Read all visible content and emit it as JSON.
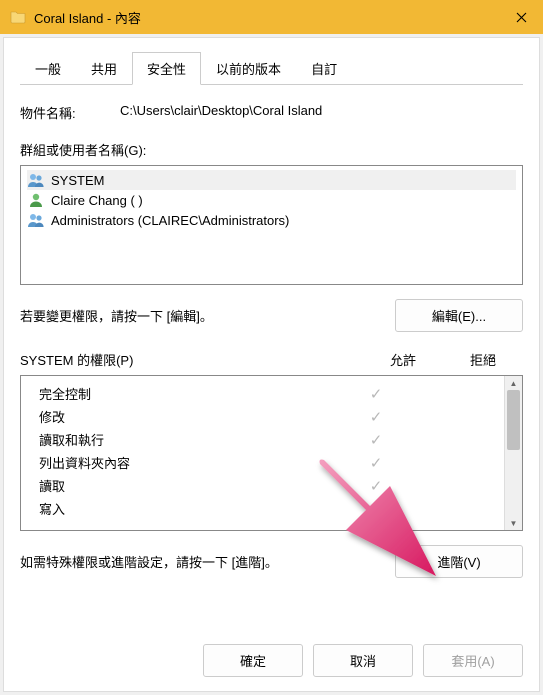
{
  "titlebar": {
    "title": "Coral Island - 內容"
  },
  "tabs": {
    "general": "一般",
    "sharing": "共用",
    "security": "安全性",
    "previous": "以前的版本",
    "custom": "自訂"
  },
  "object": {
    "label": "物件名稱:",
    "value": "C:\\Users\\clair\\Desktop\\Coral Island"
  },
  "groups": {
    "label": "群組或使用者名稱(G):",
    "items": [
      {
        "name": "SYSTEM",
        "kind": "group"
      },
      {
        "name": "Claire Chang (                                                       )",
        "kind": "user"
      },
      {
        "name": "Administrators (CLAIREC\\Administrators)",
        "kind": "group"
      }
    ]
  },
  "edit": {
    "hint": "若要變更權限，請按一下 [編輯]。",
    "button": "編輯(E)..."
  },
  "perm": {
    "header_template": "{0} 的權限(P)",
    "selected_principal": "SYSTEM",
    "col_allow": "允許",
    "col_deny": "拒絕",
    "rows": [
      {
        "name": "完全控制",
        "allow": true,
        "deny": false
      },
      {
        "name": "修改",
        "allow": true,
        "deny": false
      },
      {
        "name": "讀取和執行",
        "allow": true,
        "deny": false
      },
      {
        "name": "列出資料夾內容",
        "allow": true,
        "deny": false
      },
      {
        "name": "讀取",
        "allow": true,
        "deny": false
      },
      {
        "name": "寫入",
        "allow": true,
        "deny": false
      }
    ]
  },
  "advanced": {
    "hint": "如需特殊權限或進階設定，請按一下 [進階]。",
    "button": "進階(V)"
  },
  "footer": {
    "ok": "確定",
    "cancel": "取消",
    "apply": "套用(A)"
  },
  "arrow": {
    "color_start": "#f4a0bf",
    "color_end": "#d7175f"
  }
}
